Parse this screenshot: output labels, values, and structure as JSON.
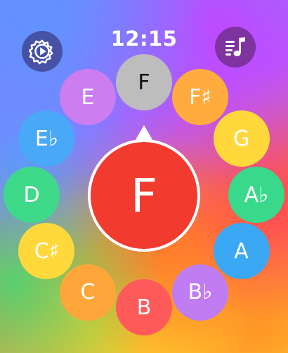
{
  "status": {
    "time": "12:15"
  },
  "toolbar": {
    "settings_icon": "gear-play-icon",
    "music_icon": "music-list-icon"
  },
  "wheel": {
    "selected_label": "F",
    "notes": [
      {
        "label": "F",
        "color": "#bdbdbd",
        "selected": true
      },
      {
        "label": "F♯",
        "color": "#ffab3d"
      },
      {
        "label": "G",
        "color": "#ffd93b"
      },
      {
        "label": "A♭",
        "color": "#38d98a"
      },
      {
        "label": "A",
        "color": "#3aa8f5"
      },
      {
        "label": "B♭",
        "color": "#c07cf2"
      },
      {
        "label": "B",
        "color": "#ff5a5a"
      },
      {
        "label": "C",
        "color": "#ffa63a"
      },
      {
        "label": "C♯",
        "color": "#ffd93b"
      },
      {
        "label": "D",
        "color": "#3fd98a"
      },
      {
        "label": "E♭",
        "color": "#49a8f7"
      },
      {
        "label": "E",
        "color": "#cc7df0"
      }
    ]
  },
  "center": {
    "label": "F",
    "color": "#f03b2e"
  }
}
